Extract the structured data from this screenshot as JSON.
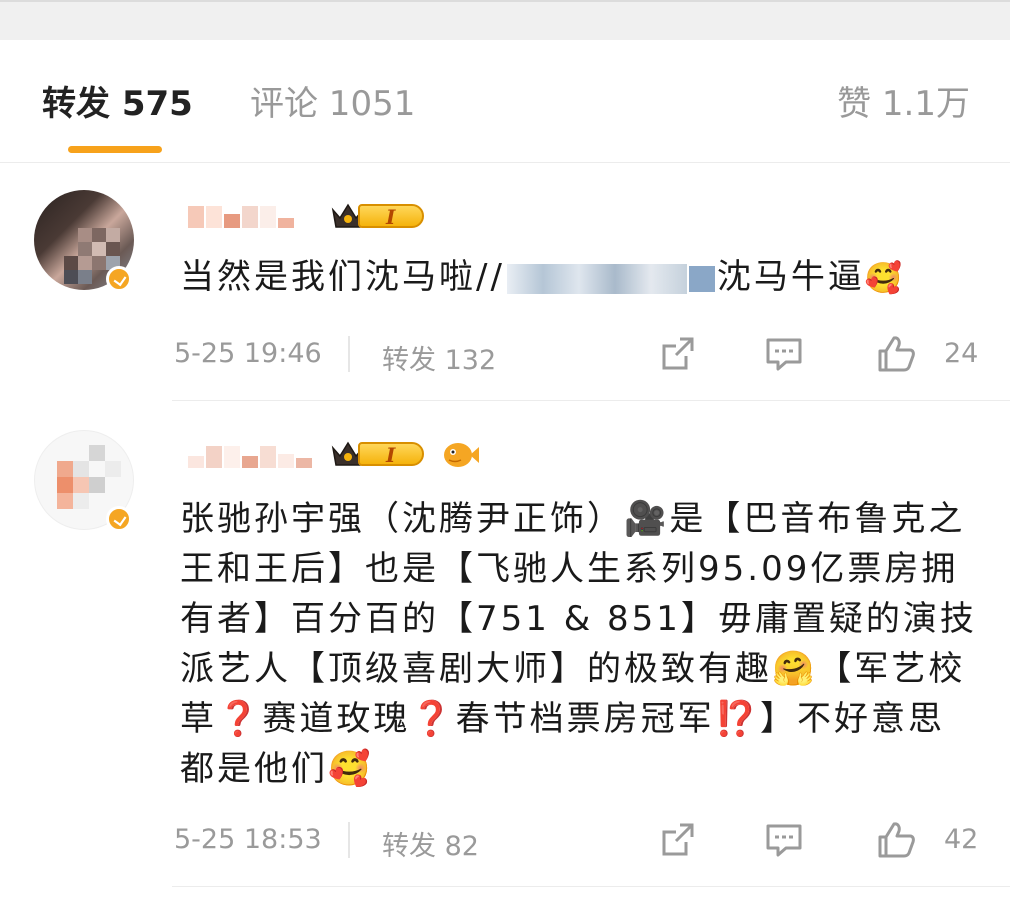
{
  "tabs": {
    "repost": "转发 575",
    "comment": "评论 1051",
    "like": "赞 1.1万"
  },
  "posts": [
    {
      "content_before": "当然是我们沈马啦//",
      "content_after": "沈马牛逼",
      "emoji_end": "🥰",
      "time": "5-25 19:46",
      "repost": "转发 132",
      "like_count": "24"
    },
    {
      "content": "张驰孙宇强（沈腾尹正饰）🎥是【巴音布鲁克之王和王后】也是【飞驰人生系列95.09亿票房拥有者】百分百的【751 & 851】毋庸置疑的演技派艺人【顶级喜剧大师】的极致有趣🤗【军艺校草❓赛道玫瑰❓春节档票房冠军⁉️】不好意思都是他们🥰",
      "time": "5-25 18:53",
      "repost": "转发 82",
      "like_count": "42"
    }
  ],
  "colors": {
    "accent": "#f7a21b",
    "meta_gray": "#9a9a9a",
    "text": "#1a1a1a"
  }
}
